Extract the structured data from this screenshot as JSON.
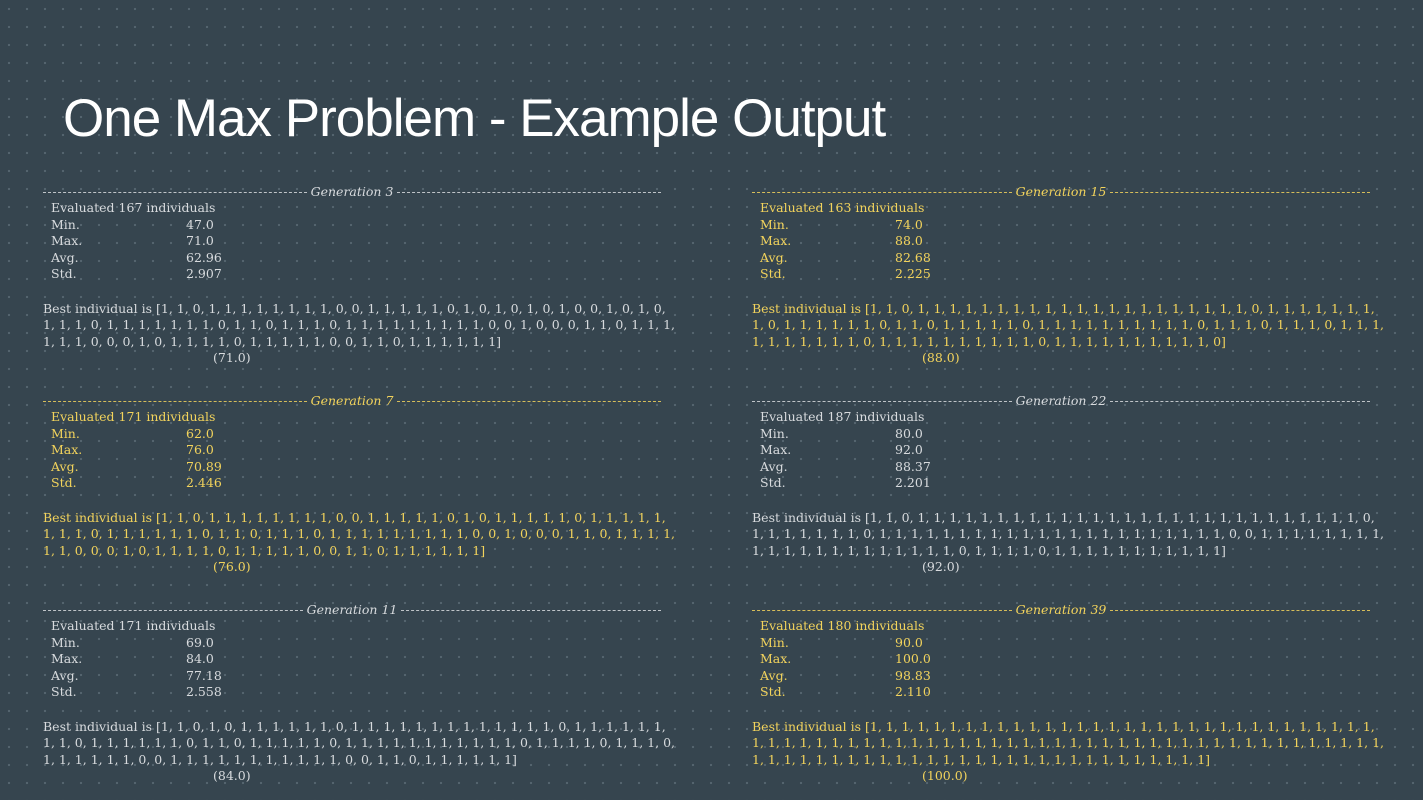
{
  "title": "One Max Problem - Example Output",
  "stat_labels": {
    "min": "Min.",
    "max": "Max.",
    "avg": "Avg.",
    "std": "Std."
  },
  "best_label": "Best individual is",
  "colors": {
    "background": "#36454f",
    "highlight": "#f2d35c",
    "normal": "#d8dbde"
  },
  "blocks": [
    {
      "generation": "Generation 3",
      "evaluated": "Evaluated 167 individuals",
      "min": "47.0",
      "max": "71.0",
      "avg": "62.96",
      "std": "2.907",
      "best": "[1, 1, 0, 1, 1, 1, 1, 1, 1, 1, 1, 0, 0, 1, 1, 1, 1, 1, 0, 1, 0, 1, 0, 1, 0, 1, 0, 0, 1, 0, 1, 0, 1, 1, 1, 0, 1, 1, 1, 1, 1, 1, 1, 0, 1, 1, 0, 1, 1, 1, 0, 1, 1, 1, 1, 1, 1, 1, 1, 1, 0, 0, 1, 0, 0, 0, 1, 1, 0, 1, 1, 1, 1, 1, 1, 0, 0, 0, 1, 0, 1, 1, 1, 1, 0, 1, 1, 1, 1, 1, 0, 0, 1, 1, 0, 1, 1, 1, 1, 1, 1]",
      "fitness": "(71.0)"
    },
    {
      "generation": "Generation 7",
      "evaluated": "Evaluated 171 individuals",
      "min": "62.0",
      "max": "76.0",
      "avg": "70.89",
      "std": "2.446",
      "best": "[1, 1, 0, 1, 1, 1, 1, 1, 1, 1, 1, 0, 0, 1, 1, 1, 1, 1, 0, 1, 0, 1, 1, 1, 1, 1, 0, 1, 1, 1, 1, 1, 1, 1, 1, 0, 1, 1, 1, 1, 1, 1, 0, 1, 1, 0, 1, 1, 1, 0, 1, 1, 1, 1, 1, 1, 1, 1, 1, 0, 0, 1, 0, 0, 0, 1, 1, 0, 1, 1, 1, 1, 1, 1, 0, 0, 0, 1, 0, 1, 1, 1, 1, 0, 1, 1, 1, 1, 1, 0, 0, 1, 1, 0, 1, 1, 1, 1, 1, 1]",
      "fitness": "(76.0)"
    },
    {
      "generation": "Generation 11",
      "evaluated": "Evaluated 171 individuals",
      "min": "69.0",
      "max": "84.0",
      "avg": "77.18",
      "std": "2.558",
      "best": "[1, 1, 0, 1, 0, 1, 1, 1, 1, 1, 1, 0, 1, 1, 1, 1, 1, 1, 1, 1, 1, 1, 1, 1, 1, 0, 1, 1, 1, 1, 1, 1, 1, 1, 0, 1, 1, 1, 1, 1, 1, 0, 1, 1, 0, 1, 1, 1, 1, 1, 0, 1, 1, 1, 1, 1, 1, 1, 1, 1, 1, 1, 0, 1, 1, 1, 1, 0, 1, 1, 1, 0, 1, 1, 1, 1, 1, 1, 0, 0, 1, 1, 1, 1, 1, 1, 1, 1, 1, 1, 1, 0, 0, 1, 1, 0, 1, 1, 1, 1, 1, 1]",
      "fitness": "(84.0)"
    },
    {
      "generation": "Generation 15",
      "evaluated": "Evaluated 163 individuals",
      "min": "74.0",
      "max": "88.0",
      "avg": "82.68",
      "std": "2.225",
      "best": "[1, 1, 0, 1, 1, 1, 1, 1, 1, 1, 1, 1, 1, 1, 1, 1, 1, 1, 1, 1, 1, 1, 1, 1, 0, 1, 1, 1, 1, 1, 1, 1, 1, 0, 1, 1, 1, 1, 1, 1, 0, 1, 1, 0, 1, 1, 1, 1, 1, 0, 1, 1, 1, 1, 1, 1, 1, 1, 1, 1, 0, 1, 1, 1, 0, 1, 1, 1, 0, 1, 1, 1, 1, 1, 1, 1, 1, 1, 1, 0, 1, 1, 1, 1, 1, 1, 1, 1, 1, 1, 0, 1, 1, 1, 1, 1, 1, 1, 1, 1, 1, 0]",
      "fitness": "(88.0)"
    },
    {
      "generation": "Generation 22",
      "evaluated": "Evaluated 187 individuals",
      "min": "80.0",
      "max": "92.0",
      "avg": "88.37",
      "std": "2.201",
      "best": "[1, 1, 0, 1, 1, 1, 1, 1, 1, 1, 1, 1, 1, 1, 1, 1, 1, 1, 1, 1, 1, 1, 1, 1, 1, 1, 1, 1, 1, 1, 1, 0, 1, 1, 1, 1, 1, 1, 1, 0, 1, 1, 1, 1, 1, 1, 1, 1, 1, 1, 1, 1, 1, 1, 1, 1, 1, 1, 1, 1, 1, 1, 0, 0, 1, 1, 1, 1, 1, 1, 1, 1, 1, 1, 1, 1, 1, 1, 1, 1, 1, 1, 1, 1, 1, 0, 1, 1, 1, 1, 0, 1, 1, 1, 1, 1, 1, 1, 1, 1, 1, 1]",
      "fitness": "(92.0)"
    },
    {
      "generation": "Generation 39",
      "evaluated": "Evaluated 180 individuals",
      "min": "90.0",
      "max": "100.0",
      "avg": "98.83",
      "std": "2.110",
      "best": "[1, 1, 1, 1, 1, 1, 1, 1, 1, 1, 1, 1, 1, 1, 1, 1, 1, 1, 1, 1, 1, 1, 1, 1, 1, 1, 1, 1, 1, 1, 1, 1, 1, 1, 1, 1, 1, 1, 1, 1, 1, 1, 1, 1, 1, 1, 1, 1, 1, 1, 1, 1, 1, 1, 1, 1, 1, 1, 1, 1, 1, 1, 1, 1, 1, 1, 1, 1, 1, 1, 1, 1, 1, 1, 1, 1, 1, 1, 1, 1, 1, 1, 1, 1, 1, 1, 1, 1, 1, 1, 1, 1, 1, 1, 1, 1, 1, 1, 1, 1, 1]",
      "fitness": "(100.0)"
    }
  ]
}
